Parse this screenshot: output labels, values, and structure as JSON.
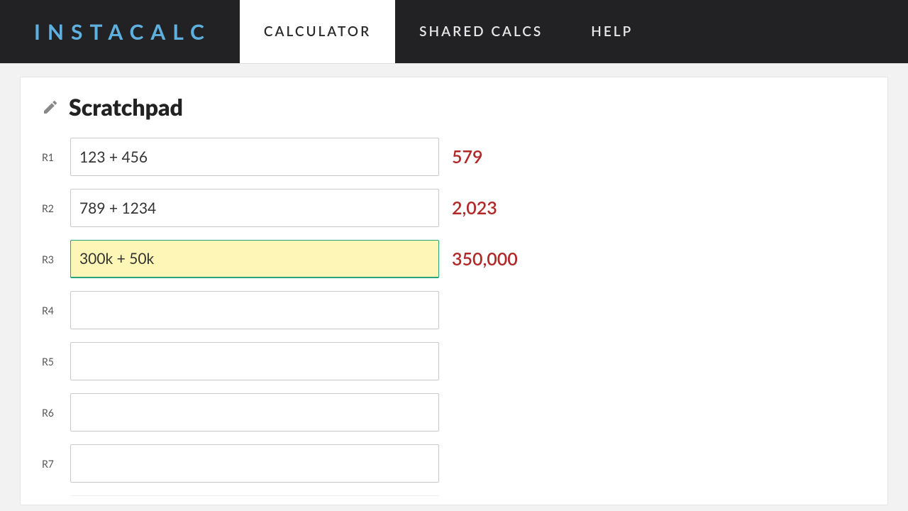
{
  "header": {
    "logo": "INSTACALC",
    "nav": [
      {
        "label": "CALCULATOR",
        "active": true
      },
      {
        "label": "SHARED CALCS",
        "active": false
      },
      {
        "label": "HELP",
        "active": false
      }
    ]
  },
  "page": {
    "title": "Scratchpad"
  },
  "rows": [
    {
      "id": "R1",
      "expr": "123 + 456",
      "result": "579",
      "active": false
    },
    {
      "id": "R2",
      "expr": "789 + 1234",
      "result": "2,023",
      "active": false
    },
    {
      "id": "R3",
      "expr": "300k + 50k",
      "result": "350,000",
      "active": true
    },
    {
      "id": "R4",
      "expr": "",
      "result": "",
      "active": false
    },
    {
      "id": "R5",
      "expr": "",
      "result": "",
      "active": false
    },
    {
      "id": "R6",
      "expr": "",
      "result": "",
      "active": false
    },
    {
      "id": "R7",
      "expr": "",
      "result": "",
      "active": false
    }
  ]
}
